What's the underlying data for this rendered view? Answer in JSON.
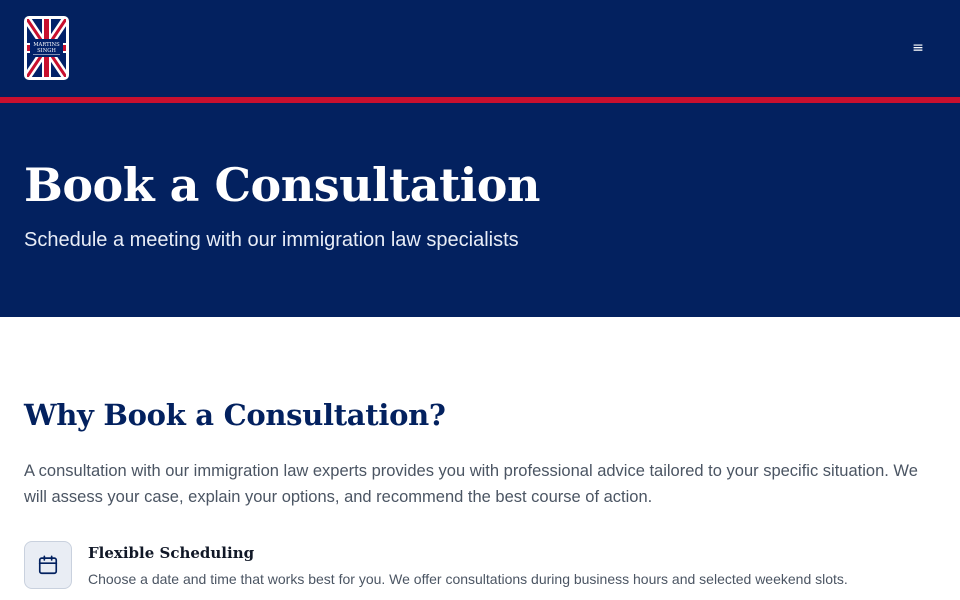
{
  "header": {
    "logo_text": "MARTINS SINGH",
    "menu_icon": "hamburger-menu-icon",
    "menu_glyph": "≡"
  },
  "hero": {
    "title": "Book a Consultation",
    "subtitle": "Schedule a meeting with our immigration law specialists"
  },
  "main": {
    "section_title": "Why Book a Consultation?",
    "intro": "A consultation with our immigration law experts provides you with professional advice tailored to your specific situation. We will assess your case, explain your options, and recommend the best course of action.",
    "features": [
      {
        "icon": "calendar-icon",
        "title": "Flexible Scheduling",
        "description": "Choose a date and time that works best for you. We offer consultations during business hours and selected weekend slots."
      }
    ]
  },
  "colors": {
    "navy": "#03215f",
    "red": "#c8102e",
    "text_gray": "#4b5563"
  }
}
